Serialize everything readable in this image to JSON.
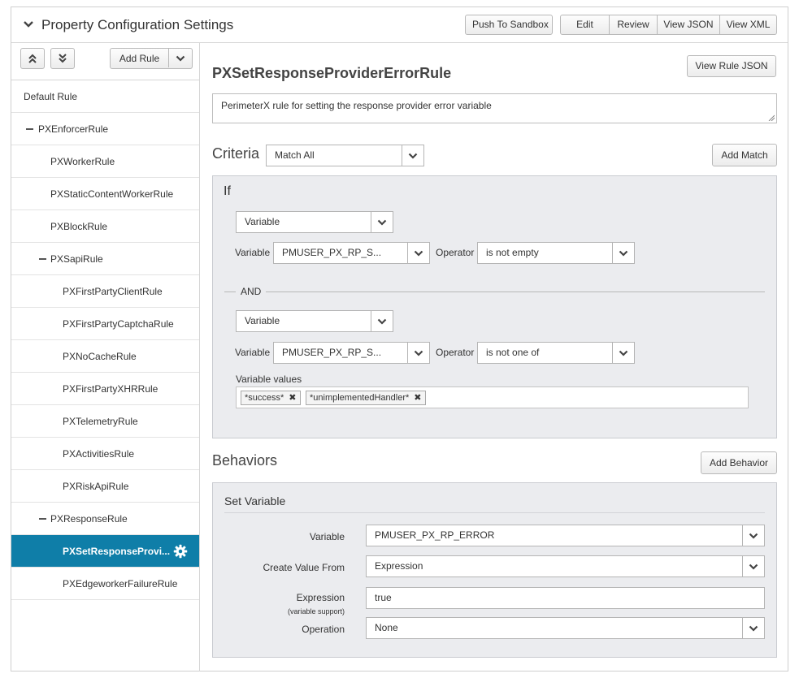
{
  "header": {
    "title": "Property Configuration Settings",
    "push_to_sandbox": "Push To Sandbox",
    "edit": "Edit",
    "review": "Review",
    "view_json": "View JSON",
    "view_xml": "View XML"
  },
  "sidebar": {
    "add_rule": "Add Rule",
    "rules": [
      {
        "label": "Default Rule",
        "level": 0,
        "collapsible": false
      },
      {
        "label": "PXEnforcerRule",
        "level": 0,
        "collapsible": true
      },
      {
        "label": "PXWorkerRule",
        "level": 1,
        "collapsible": false
      },
      {
        "label": "PXStaticContentWorkerRule",
        "level": 1,
        "collapsible": false
      },
      {
        "label": "PXBlockRule",
        "level": 1,
        "collapsible": false
      },
      {
        "label": "PXSapiRule",
        "level": 1,
        "collapsible": true
      },
      {
        "label": "PXFirstPartyClientRule",
        "level": 2,
        "collapsible": false
      },
      {
        "label": "PXFirstPartyCaptchaRule",
        "level": 2,
        "collapsible": false
      },
      {
        "label": "PXNoCacheRule",
        "level": 2,
        "collapsible": false
      },
      {
        "label": "PXFirstPartyXHRRule",
        "level": 2,
        "collapsible": false
      },
      {
        "label": "PXTelemetryRule",
        "level": 2,
        "collapsible": false
      },
      {
        "label": "PXActivitiesRule",
        "level": 2,
        "collapsible": false
      },
      {
        "label": "PXRiskApiRule",
        "level": 2,
        "collapsible": false
      },
      {
        "label": "PXResponseRule",
        "level": 1,
        "collapsible": true
      },
      {
        "label": "PXSetResponseProvi...",
        "level": 2,
        "collapsible": false,
        "selected": true
      },
      {
        "label": "PXEdgeworkerFailureRule",
        "level": 2,
        "collapsible": false
      }
    ]
  },
  "main": {
    "rule_name": "PXSetResponseProviderErrorRule",
    "view_rule_json": "View Rule JSON",
    "comment": "PerimeterX rule for setting the response provider error variable",
    "criteria": {
      "title": "Criteria",
      "match_mode": "Match All",
      "add_match": "Add Match",
      "if_label": "If",
      "and_label": "AND",
      "conditions": [
        {
          "type": "Variable",
          "variable_label": "Variable",
          "variable": "PMUSER_PX_RP_S...",
          "operator_label": "Operator",
          "operator": "is not empty"
        },
        {
          "type": "Variable",
          "variable_label": "Variable",
          "variable": "PMUSER_PX_RP_S...",
          "operator_label": "Operator",
          "operator": "is not one of",
          "values_label": "Variable values",
          "values": [
            "*success*",
            "*unimplementedHandler*"
          ]
        }
      ]
    },
    "behaviors": {
      "title": "Behaviors",
      "add_behavior": "Add Behavior",
      "set_variable": {
        "title": "Set Variable",
        "variable_label": "Variable",
        "variable": "PMUSER_PX_RP_ERROR",
        "create_value_from_label": "Create Value From",
        "create_value_from": "Expression",
        "expression_label": "Expression",
        "expression_note": "(variable support)",
        "expression": "true",
        "operation_label": "Operation",
        "operation": "None"
      }
    }
  },
  "colors": {
    "selected_rule_bg": "#0f7ea8",
    "panel_bg": "#ebecef"
  }
}
